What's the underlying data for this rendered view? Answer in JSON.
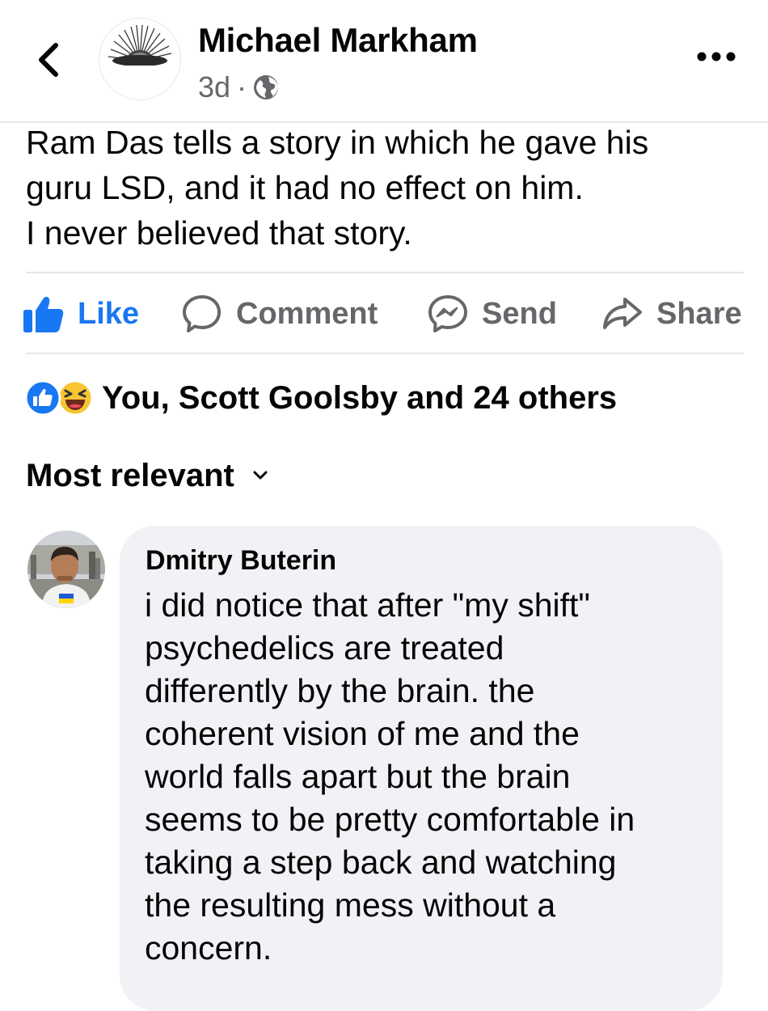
{
  "header": {
    "author_name": "Michael Markham",
    "time_ago": "3d",
    "separator": "·",
    "audience_icon": "globe-icon",
    "back_icon": "chevron-left-icon",
    "more_icon": "ellipsis-icon"
  },
  "post": {
    "lines": [
      "Ram Das tells a story in which he gave his",
      "guru LSD, and it had no effect on him.",
      "I never believed that story."
    ]
  },
  "actions": {
    "like": "Like",
    "comment": "Comment",
    "send": "Send",
    "share": "Share",
    "like_state": "liked"
  },
  "reactions": {
    "summary": "You, Scott Goolsby and 24 others",
    "icons": [
      "like-reaction-icon",
      "haha-reaction-icon"
    ]
  },
  "comments": {
    "sort_label": "Most relevant",
    "items": [
      {
        "author": "Dmitry Buterin",
        "lines": [
          "i did notice that after \"my shift\"",
          "psychedelics are treated",
          "differently by the brain. the",
          "coherent vision of me and the",
          "world falls apart but the brain",
          "seems to be pretty comfortable in",
          "taking a step back and watching",
          "the resulting mess without a",
          "concern."
        ]
      }
    ]
  },
  "colors": {
    "accent": "#1877f2",
    "secondary_text": "#65676b",
    "bubble_bg": "#f0f2f5",
    "divider": "#e4e6eb",
    "haha_yellow": "#f7c531"
  }
}
